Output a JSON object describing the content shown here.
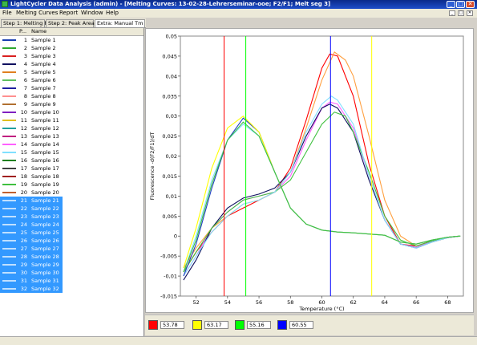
{
  "window": {
    "title": "LightCycler Data Analysis (admin) - [Melting Curves: 13-02-28-Lehrerseminar-ooe; F2/F1; Melt seg 3]",
    "buttons": [
      "_",
      "□",
      "✕"
    ],
    "mdi_buttons": [
      "_",
      "□",
      "✕"
    ]
  },
  "menu": [
    "File",
    "Melting Curves",
    "Report",
    "Window",
    "Help"
  ],
  "tabs": [
    {
      "label": "Step 1: Melting Peaks",
      "active": false
    },
    {
      "label": "Step 2: Peak Areas",
      "active": false
    },
    {
      "label": "Extra: Manual Tm",
      "active": true
    }
  ],
  "list": {
    "headers": {
      "p": "P...",
      "name": "Name"
    },
    "rows": [
      {
        "num": "1",
        "name": "Sample 1",
        "color": "#1a3fb0"
      },
      {
        "num": "2",
        "name": "Sample 2",
        "color": "#2ea82e"
      },
      {
        "num": "3",
        "name": "Sample 3",
        "color": "#d92020"
      },
      {
        "num": "4",
        "name": "Sample 4",
        "color": "#101060"
      },
      {
        "num": "5",
        "name": "Sample 5",
        "color": "#e08020"
      },
      {
        "num": "6",
        "name": "Sample 6",
        "color": "#60c060"
      },
      {
        "num": "7",
        "name": "Sample 7",
        "color": "#2020a0"
      },
      {
        "num": "8",
        "name": "Sample 8",
        "color": "#ff9090"
      },
      {
        "num": "9",
        "name": "Sample 9",
        "color": "#b07030"
      },
      {
        "num": "10",
        "name": "Sample 10",
        "color": "#8020c0"
      },
      {
        "num": "11",
        "name": "Sample 11",
        "color": "#e0c020"
      },
      {
        "num": "12",
        "name": "Sample 12",
        "color": "#20a0a0"
      },
      {
        "num": "13",
        "name": "Sample 13",
        "color": "#c02080"
      },
      {
        "num": "14",
        "name": "Sample 14",
        "color": "#ff60ff"
      },
      {
        "num": "15",
        "name": "Sample 15",
        "color": "#80e0ff"
      },
      {
        "num": "16",
        "name": "Sample 16",
        "color": "#208020"
      },
      {
        "num": "17",
        "name": "Sample 17",
        "color": "#404040"
      },
      {
        "num": "18",
        "name": "Sample 18",
        "color": "#a02020"
      },
      {
        "num": "19",
        "name": "Sample 19",
        "color": "#40c040"
      },
      {
        "num": "20",
        "name": "Sample 20",
        "color": "#c06030"
      },
      {
        "num": "21",
        "name": "Sample 21",
        "color": "#c0e0ff",
        "selected": true
      },
      {
        "num": "22",
        "name": "Sample 22",
        "color": "#c0e0ff",
        "selected": true
      },
      {
        "num": "23",
        "name": "Sample 23",
        "color": "#c0e0ff",
        "selected": true
      },
      {
        "num": "24",
        "name": "Sample 24",
        "color": "#c0e0ff",
        "selected": true
      },
      {
        "num": "25",
        "name": "Sample 25",
        "color": "#c0e0ff",
        "selected": true
      },
      {
        "num": "26",
        "name": "Sample 26",
        "color": "#c0e0ff",
        "selected": true
      },
      {
        "num": "27",
        "name": "Sample 27",
        "color": "#c0e0ff",
        "selected": true
      },
      {
        "num": "28",
        "name": "Sample 28",
        "color": "#c0e0ff",
        "selected": true
      },
      {
        "num": "29",
        "name": "Sample 29",
        "color": "#c0e0ff",
        "selected": true
      },
      {
        "num": "30",
        "name": "Sample 30",
        "color": "#c0e0ff",
        "selected": true
      },
      {
        "num": "31",
        "name": "Sample 31",
        "color": "#c0e0ff",
        "selected": true
      },
      {
        "num": "32",
        "name": "Sample 32",
        "color": "#c0e0ff",
        "selected": true
      }
    ]
  },
  "chart_data": {
    "type": "line",
    "title": "",
    "xlabel": "Temperature (°C)",
    "ylabel": "Fluorescence -d(F2/F1)/dT",
    "xlim": [
      51,
      69
    ],
    "ylim": [
      -0.015,
      0.05
    ],
    "xticks": [
      52,
      54,
      56,
      58,
      60,
      62,
      64,
      66,
      68
    ],
    "yticks": [
      -0.015,
      -0.01,
      -0.005,
      0,
      0.005,
      0.01,
      0.015,
      0.02,
      0.025,
      0.03,
      0.035,
      0.04,
      0.045,
      0.05
    ],
    "ytick_labels": [
      "-0,015",
      "-0,01",
      "-0,005",
      "0",
      "0,005",
      "0,01",
      "0,015",
      "0,02",
      "0,025",
      "0,03",
      "0,035",
      "0,04",
      "0,045",
      "0,05"
    ],
    "grid": false,
    "cursor_lines": [
      {
        "x": 53.78,
        "color": "#ff0000"
      },
      {
        "x": 63.17,
        "color": "#ffff00"
      },
      {
        "x": 55.16,
        "color": "#00ff00"
      },
      {
        "x": 60.55,
        "color": "#0000ff"
      }
    ],
    "series": [
      {
        "color": "#ff0000",
        "x": [
          51.2,
          52,
          53,
          54,
          55,
          56,
          57,
          58,
          59,
          60,
          60.5,
          61,
          62,
          63,
          64,
          65,
          66,
          67,
          68,
          68.8
        ],
        "y": [
          -0.009,
          -0.004,
          0.001,
          0.005,
          0.007,
          0.009,
          0.011,
          0.017,
          0.029,
          0.042,
          0.0455,
          0.045,
          0.035,
          0.018,
          0.005,
          -0.002,
          -0.0025,
          -0.0012,
          -0.0003,
          0
        ]
      },
      {
        "color": "#ffa040",
        "x": [
          51.2,
          52,
          53,
          54,
          55,
          56,
          57,
          58,
          59,
          60,
          60.8,
          61.5,
          62,
          63,
          64,
          65,
          66,
          67,
          68,
          68.8
        ],
        "y": [
          -0.008,
          -0.003,
          0.002,
          0.005,
          0.008,
          0.009,
          0.011,
          0.016,
          0.027,
          0.039,
          0.046,
          0.044,
          0.04,
          0.025,
          0.009,
          0,
          -0.0025,
          -0.0015,
          -0.0004,
          0
        ]
      },
      {
        "color": "#ff60ff",
        "x": [
          51.2,
          52,
          53,
          54,
          55,
          56,
          57,
          58,
          59,
          60,
          60.5,
          61,
          62,
          63,
          64,
          65,
          66,
          67,
          68,
          68.8
        ],
        "y": [
          -0.01,
          -0.005,
          0.002,
          0.006,
          0.009,
          0.01,
          0.011,
          0.015,
          0.024,
          0.032,
          0.0335,
          0.033,
          0.027,
          0.015,
          0.004,
          -0.002,
          -0.0028,
          -0.0014,
          -0.0004,
          0
        ]
      },
      {
        "color": "#101060",
        "x": [
          51.2,
          52,
          53,
          54,
          55,
          56,
          57,
          58,
          59,
          60,
          60.5,
          61,
          62,
          63,
          64,
          65,
          66,
          67,
          68,
          68.8
        ],
        "y": [
          -0.011,
          -0.006,
          0.002,
          0.007,
          0.0095,
          0.0105,
          0.012,
          0.016,
          0.025,
          0.032,
          0.033,
          0.032,
          0.026,
          0.014,
          0.004,
          -0.002,
          -0.003,
          -0.0015,
          -0.0004,
          0
        ]
      },
      {
        "color": "#40c040",
        "x": [
          51.2,
          52,
          53,
          54,
          55,
          56,
          57,
          58,
          59,
          60,
          60.8,
          61.5,
          62,
          63,
          64,
          65,
          66,
          67,
          68,
          68.8
        ],
        "y": [
          -0.009,
          -0.004,
          0.002,
          0.006,
          0.009,
          0.01,
          0.011,
          0.014,
          0.021,
          0.028,
          0.031,
          0.03,
          0.026,
          0.016,
          0.005,
          -0.001,
          -0.0025,
          -0.0012,
          -0.0003,
          0
        ]
      },
      {
        "color": "#80e0ff",
        "x": [
          51.2,
          52,
          53,
          54,
          55,
          56,
          57,
          58,
          59,
          60,
          60.6,
          61,
          62,
          63,
          64,
          65,
          66,
          67,
          68,
          68.8
        ],
        "y": [
          -0.01,
          -0.005,
          0.001,
          0.005,
          0.008,
          0.009,
          0.011,
          0.016,
          0.026,
          0.033,
          0.035,
          0.034,
          0.028,
          0.015,
          0.004,
          -0.002,
          -0.003,
          -0.0015,
          -0.0004,
          0
        ]
      },
      {
        "color": "#2040c0",
        "x": [
          51.2,
          52,
          53,
          54,
          55,
          56,
          57,
          58,
          59,
          60,
          61,
          62,
          63,
          64,
          65,
          66,
          67,
          68,
          68.8
        ],
        "y": [
          -0.01,
          -0.002,
          0.012,
          0.024,
          0.0295,
          0.026,
          0.016,
          0.007,
          0.003,
          0.0015,
          0.001,
          0.0008,
          0.0005,
          0.0002,
          -0.0015,
          -0.002,
          -0.001,
          -0.0003,
          0
        ]
      },
      {
        "color": "#ffff00",
        "x": [
          51.2,
          52,
          53,
          54,
          55,
          56,
          57,
          58,
          59,
          60,
          61,
          62,
          63,
          64,
          65,
          66,
          67,
          68,
          68.8
        ],
        "y": [
          -0.008,
          0.002,
          0.017,
          0.027,
          0.03,
          0.026,
          0.016,
          0.007,
          0.003,
          0.0015,
          0.001,
          0.0008,
          0.0005,
          0.0002,
          -0.0015,
          -0.002,
          -0.001,
          -0.0003,
          0
        ]
      },
      {
        "color": "#80e0ff",
        "x": [
          51.2,
          52,
          53,
          54,
          55,
          56,
          57,
          58,
          59,
          60,
          61,
          62,
          63,
          64,
          65,
          66,
          67,
          68,
          68.8
        ],
        "y": [
          -0.009,
          0,
          0.014,
          0.024,
          0.028,
          0.025,
          0.016,
          0.007,
          0.003,
          0.0015,
          0.001,
          0.0008,
          0.0005,
          0.0002,
          -0.0015,
          -0.002,
          -0.001,
          -0.0003,
          0
        ]
      },
      {
        "color": "#40c040",
        "x": [
          51.2,
          52,
          53,
          54,
          55,
          56,
          57,
          58,
          59,
          60,
          61,
          62,
          63,
          64,
          65,
          66,
          67,
          68,
          68.8
        ],
        "y": [
          -0.009,
          -0.001,
          0.013,
          0.024,
          0.0285,
          0.025,
          0.016,
          0.007,
          0.003,
          0.0015,
          0.001,
          0.0008,
          0.0005,
          0.0002,
          -0.0015,
          -0.002,
          -0.001,
          -0.0003,
          0
        ]
      }
    ]
  },
  "legend": [
    {
      "color": "#ff0000",
      "value": "53.78"
    },
    {
      "color": "#ffff00",
      "value": "63.17"
    },
    {
      "color": "#00ff00",
      "value": "55.16"
    },
    {
      "color": "#0000ff",
      "value": "60.55"
    }
  ]
}
